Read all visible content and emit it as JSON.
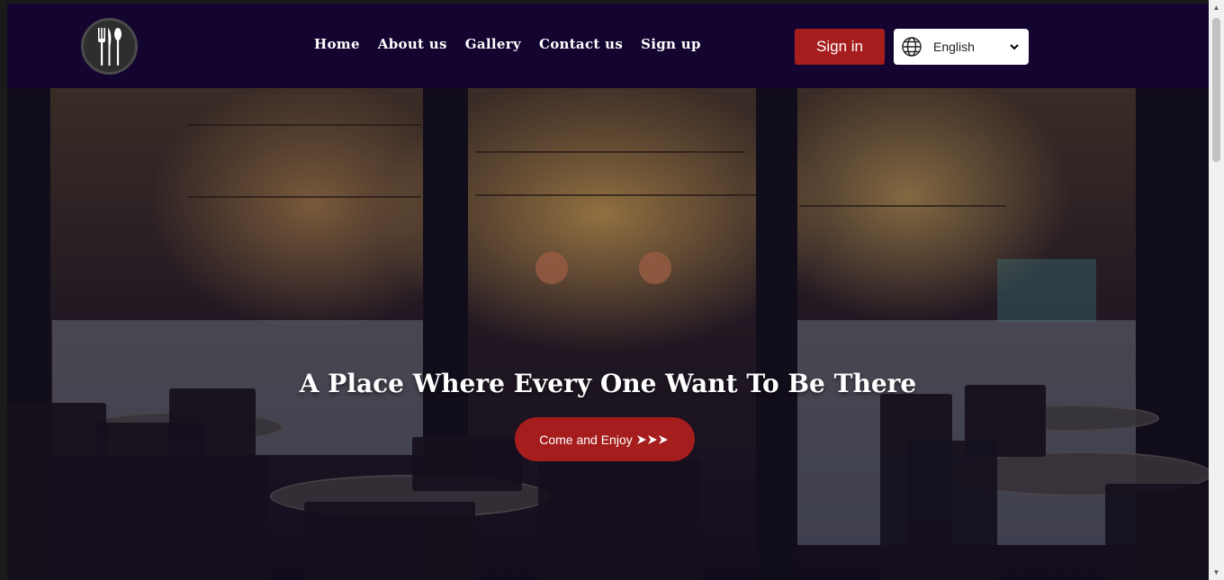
{
  "navbar": {
    "links": [
      {
        "label": "Home"
      },
      {
        "label": "About us"
      },
      {
        "label": "Gallery"
      },
      {
        "label": "Contact us"
      },
      {
        "label": "Sign up"
      }
    ],
    "signin_label": "Sign in",
    "language": {
      "selected": "English",
      "icon": "globe-icon"
    },
    "logo_icon": "cutlery-icon"
  },
  "hero": {
    "title": "A Place Where Every One Want To Be There",
    "cta_label": "Come and Enjoy",
    "cta_icon": "triple-arrow-icon"
  },
  "colors": {
    "nav_bg": "#130530",
    "accent": "#a61d1d"
  }
}
